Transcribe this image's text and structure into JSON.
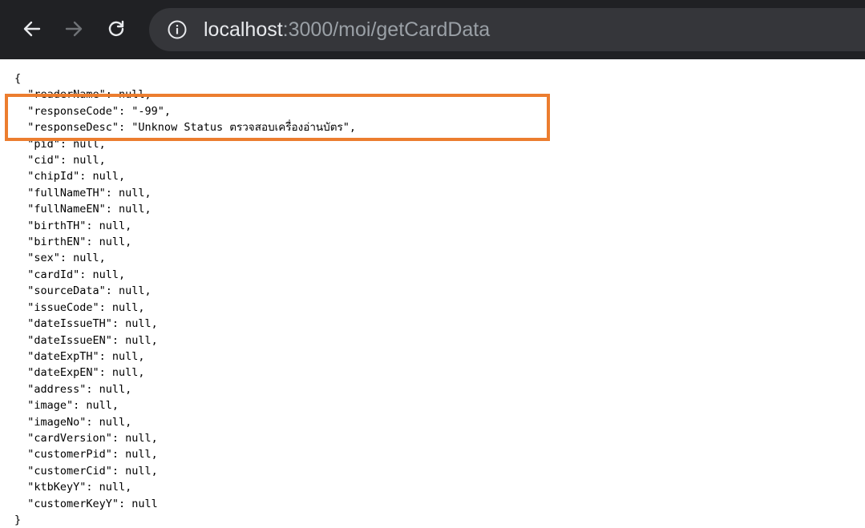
{
  "browser": {
    "url_host": "localhost",
    "url_rest": ":3000/moi/getCardData",
    "icons": {
      "back": "arrow-left-icon",
      "forward": "arrow-right-icon",
      "reload": "reload-icon",
      "info": "info-circle-icon"
    }
  },
  "response": {
    "lines": [
      "{",
      "  \"readerName\": null,",
      "  \"responseCode\": \"-99\",",
      "  \"responseDesc\": \"Unknow Status ตรวจสอบเครื่องอ่านบัตร\",",
      "  \"pid\": null,",
      "  \"cid\": null,",
      "  \"chipId\": null,",
      "  \"fullNameTH\": null,",
      "  \"fullNameEN\": null,",
      "  \"birthTH\": null,",
      "  \"birthEN\": null,",
      "  \"sex\": null,",
      "  \"cardId\": null,",
      "  \"sourceData\": null,",
      "  \"issueCode\": null,",
      "  \"dateIssueTH\": null,",
      "  \"dateIssueEN\": null,",
      "  \"dateExpTH\": null,",
      "  \"dateExpEN\": null,",
      "  \"address\": null,",
      "  \"image\": null,",
      "  \"imageNo\": null,",
      "  \"cardVersion\": null,",
      "  \"customerPid\": null,",
      "  \"customerCid\": null,",
      "  \"ktbKeyY\": null,",
      "  \"customerKeyY\": null",
      "}"
    ]
  },
  "highlight": {
    "color": "#ec7d2f"
  }
}
